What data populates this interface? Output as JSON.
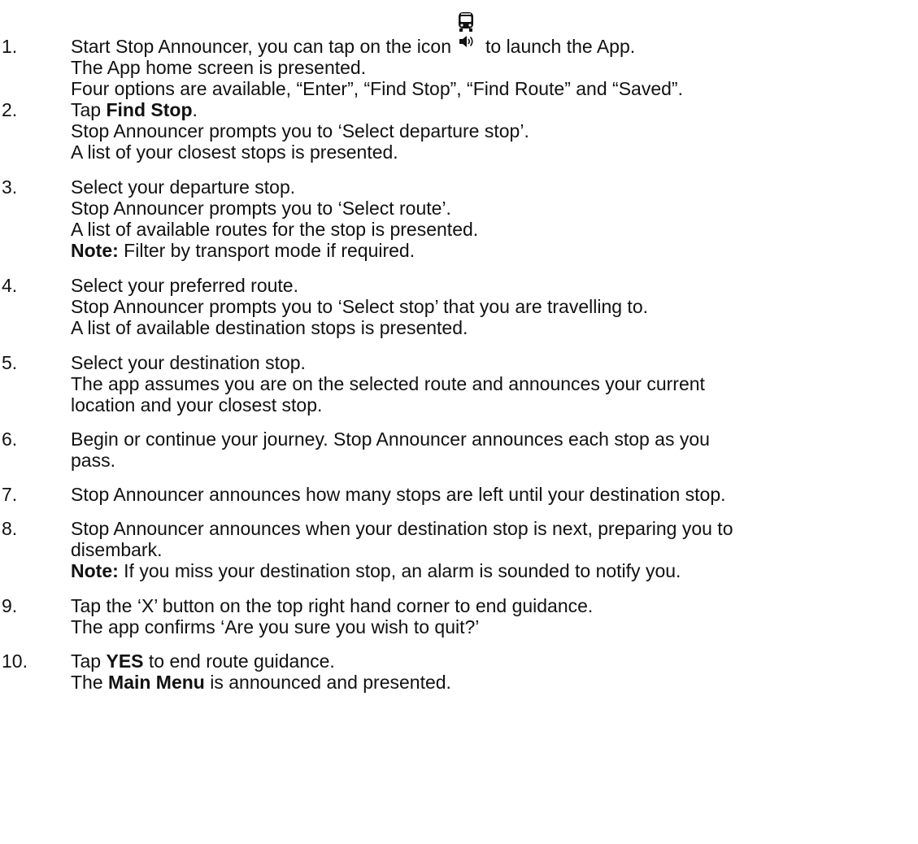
{
  "steps": [
    {
      "number": "1.",
      "lines": {
        "a_pre": "Start Stop Announcer, you can tap on the icon",
        "a_post": "to launch the App.",
        "b": "The App home screen is presented.",
        "c": "Four options are available, “Enter”, “Find Stop”, “Find Route” and “Saved”."
      },
      "icon": "bus-speaker-icon"
    },
    {
      "number": "2.",
      "lines": {
        "a_pre": "Tap ",
        "a_bold": "Find Stop",
        "a_post": ".",
        "b": "Stop Announcer prompts you to ‘Select departure stop’.",
        "c": "A list of your closest stops is presented."
      }
    },
    {
      "number": "3.",
      "lines": {
        "a": "Select your departure stop.",
        "b": "Stop Announcer prompts you to ‘Select route’.",
        "c": "A list of available routes for the stop is presented.",
        "d_bold": "Note:",
        "d_post": " Filter by transport mode if required."
      }
    },
    {
      "number": "4.",
      "lines": {
        "a": "Select your preferred route.",
        "b": "Stop Announcer prompts you to ‘Select stop’ that you are travelling to.",
        "c": "A list of available destination stops is presented."
      }
    },
    {
      "number": "5.",
      "lines": {
        "a": "Select your destination stop.",
        "b": "The app assumes you are on the selected route and announces your current",
        "c": "location and your closest stop."
      }
    },
    {
      "number": "6.",
      "lines": {
        "a": "Begin or continue your journey. Stop Announcer announces each stop as you",
        "b": "pass."
      }
    },
    {
      "number": "7.",
      "lines": {
        "a": "Stop Announcer announces how many stops are left until your destination stop."
      }
    },
    {
      "number": "8.",
      "lines": {
        "a": "Stop Announcer announces when your destination stop is next, preparing you to",
        "b": "disembark.",
        "c_bold": "Note:",
        "c_post": " If you miss your destination stop, an alarm is sounded to notify you."
      }
    },
    {
      "number": "9.",
      "lines": {
        "a": "Tap the ‘X’ button on the top right hand corner to end guidance.",
        "b": "The app confirms ‘Are you sure you wish to quit?’"
      }
    },
    {
      "number": "10.",
      "lines": {
        "a_pre": "Tap ",
        "a_bold": "YES",
        "a_post": " to end route guidance.",
        "b_pre": "The ",
        "b_bold": "Main Menu",
        "b_post": " is announced and presented."
      }
    }
  ]
}
